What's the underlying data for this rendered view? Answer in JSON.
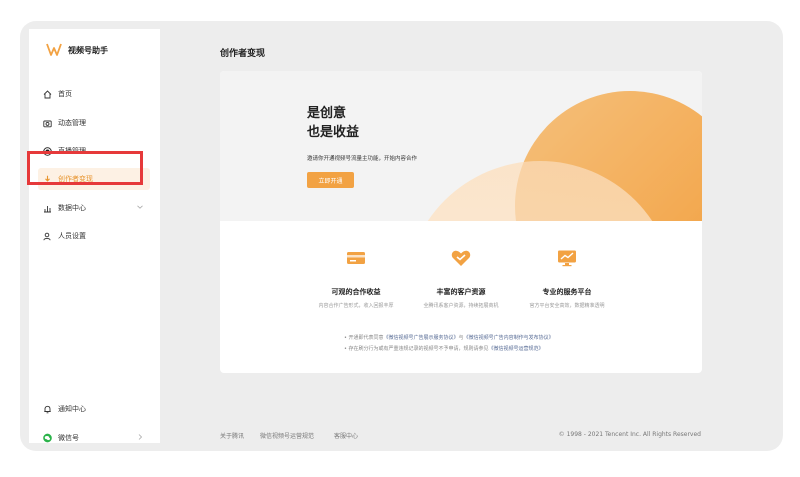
{
  "app": {
    "title": "视频号助手"
  },
  "sidebar": {
    "items": [
      {
        "label": "首页",
        "icon": "home-icon"
      },
      {
        "label": "动态管理",
        "icon": "camera-icon"
      },
      {
        "label": "直播管理",
        "icon": "live-icon"
      },
      {
        "label": "创作者变现",
        "icon": "money-icon",
        "active": true
      },
      {
        "label": "数据中心",
        "icon": "bar-chart-icon",
        "expandable": true
      },
      {
        "label": "人员设置",
        "icon": "user-icon"
      }
    ],
    "bottom": [
      {
        "label": "通知中心",
        "icon": "bell-icon"
      },
      {
        "label": "微信号",
        "icon": "wechat-icon"
      }
    ]
  },
  "main": {
    "page_title": "创作者变现",
    "hero": {
      "line1": "是创意",
      "line2": "也是收益",
      "subtitle": "邀请你开通视频号流量主功能，开始内容合作",
      "button": "立即开通"
    },
    "features": [
      {
        "title": "可观的合作收益",
        "desc": "内容合作广告形式，收入回报丰厚",
        "icon": "card-icon"
      },
      {
        "title": "丰富的客户资源",
        "desc": "全腾讯系客户资源，持续拓展商机",
        "icon": "handshake-icon"
      },
      {
        "title": "专业的服务平台",
        "desc": "官方平台安全高效，数据精准透明",
        "icon": "monitor-chart-icon"
      }
    ],
    "notes": {
      "line1_prefix": "• 开通即代表同意",
      "line1_link1": "《微信视频号广告展示服务协议》",
      "line1_mid": "与",
      "line1_link2": "《微信视频号广告内容制作与发布协议》",
      "line2_prefix": "• 存在刷分行为或有严重违规记录的视频号不予申请，规则请参见",
      "line2_link": "《微信视频号运营规范》"
    }
  },
  "footer": {
    "links": [
      "关于腾讯",
      "微信视频号运营规范",
      "客服中心"
    ],
    "copyright": "© 1998 - 2021 Tencent Inc. All Rights Reserved"
  },
  "colors": {
    "accent": "#f2a243",
    "highlight": "#e6393a",
    "link": "#576b95"
  }
}
